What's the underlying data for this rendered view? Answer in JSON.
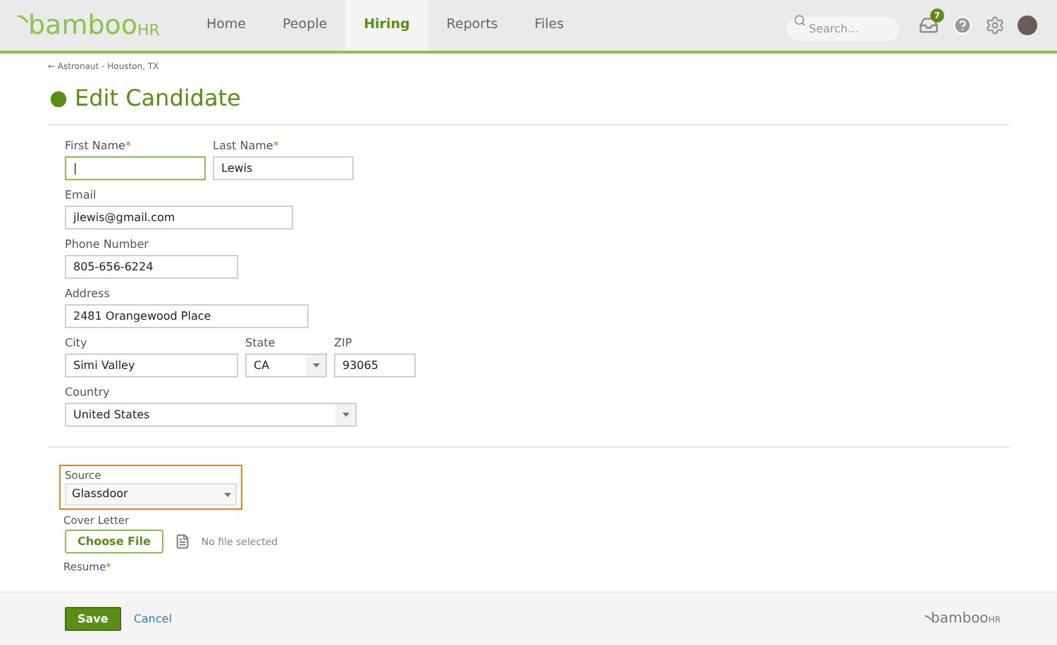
{
  "nav": {
    "logo_main": "bamboo",
    "logo_suffix": "HR",
    "tabs": [
      {
        "label": "Home",
        "selected": false
      },
      {
        "label": "People",
        "selected": false
      },
      {
        "label": "Hiring",
        "selected": true
      },
      {
        "label": "Reports",
        "selected": false
      },
      {
        "label": "Files",
        "selected": false
      }
    ],
    "search": {
      "placeholder": "Search..."
    },
    "inbox_badge": "7"
  },
  "breadcrumb": "← Astronaut - Houston, TX",
  "title": "Edit Candidate",
  "rows": [
    [
      {
        "label": "First Name",
        "required_mark": "*",
        "value": "|",
        "kind": "text",
        "focused": true
      },
      {
        "label": "Last Name",
        "required_mark": "*",
        "value": "Lewis",
        "kind": "text",
        "focused": false
      }
    ],
    [
      {
        "label": "Email",
        "value": "jlewis@gmail.com",
        "kind": "text",
        "focused": false
      }
    ],
    [
      {
        "label": "Phone Number",
        "value": "805-656-6224",
        "kind": "text",
        "focused": false
      }
    ],
    [
      {
        "label": "Address",
        "value": "2481 Orangewood Place",
        "kind": "text",
        "focused": false
      }
    ],
    [
      {
        "label": "City",
        "value": "Simi Valley",
        "kind": "text",
        "focused": false
      },
      {
        "label": "State",
        "value": "CA",
        "kind": "select",
        "focused": false
      },
      {
        "label": "ZIP",
        "value": "93065",
        "kind": "text",
        "focused": false
      }
    ],
    [
      {
        "label": "Country",
        "value": "United States",
        "kind": "select",
        "focused": false
      }
    ]
  ],
  "source": {
    "label": "Source",
    "value": "Glassdoor",
    "highlighted": true
  },
  "cover_letter": {
    "label": "Cover Letter",
    "button": "Choose File",
    "status": "No file selected"
  },
  "resume": {
    "label": "Resume",
    "required_mark": "*"
  },
  "footer": {
    "save": "Save",
    "cancel": "Cancel",
    "logo_main": "bamboo",
    "logo_suffix": "HR"
  }
}
